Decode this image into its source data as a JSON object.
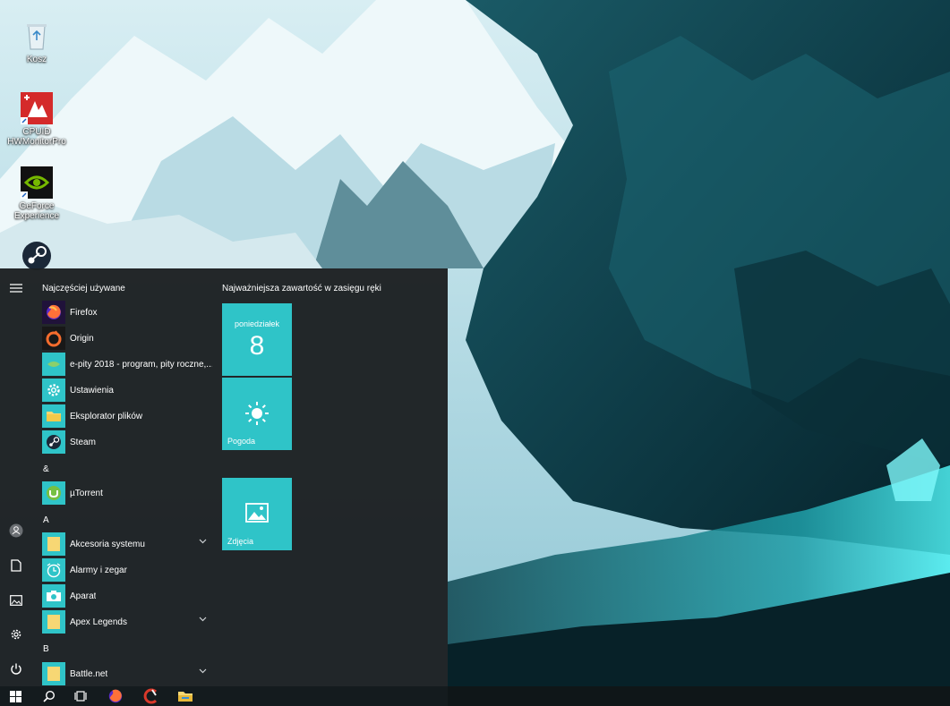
{
  "desktop": {
    "icons": [
      {
        "label": "Kosz",
        "icon": "recycle-bin-icon"
      },
      {
        "label": "CPUID\nHWMonitorPro",
        "icon": "hwmonitor-icon"
      },
      {
        "label": "GeForce Experience",
        "icon": "nvidia-icon"
      },
      {
        "label": "",
        "icon": "steam-icon"
      }
    ]
  },
  "start_menu": {
    "most_used_title": "Najczęściej używane",
    "tiles_title": "Najważniejsza zawartość w zasięgu ręki",
    "most_used": [
      {
        "label": "Firefox",
        "icon": "firefox-icon"
      },
      {
        "label": "Origin",
        "icon": "origin-icon"
      },
      {
        "label": "e-pity 2018 - program, pity roczne,...",
        "icon": "e-pity-icon"
      },
      {
        "label": "Ustawienia",
        "icon": "settings-gear-icon"
      },
      {
        "label": "Eksplorator plików",
        "icon": "folder-icon"
      },
      {
        "label": "Steam",
        "icon": "steam-icon"
      }
    ],
    "groups": [
      {
        "letter": "&",
        "items": [
          {
            "label": "µTorrent",
            "icon": "utorrent-icon",
            "expandable": false
          }
        ]
      },
      {
        "letter": "A",
        "items": [
          {
            "label": "Akcesoria systemu",
            "icon": "folder-icon",
            "expandable": true
          },
          {
            "label": "Alarmy i zegar",
            "icon": "alarm-clock-icon",
            "expandable": false
          },
          {
            "label": "Aparat",
            "icon": "camera-icon",
            "expandable": false
          },
          {
            "label": "Apex Legends",
            "icon": "folder-icon",
            "expandable": true
          }
        ]
      },
      {
        "letter": "B",
        "items": [
          {
            "label": "Battle.net",
            "icon": "folder-icon",
            "expandable": true
          }
        ]
      }
    ],
    "tiles": {
      "calendar": {
        "day": "poniedziałek",
        "date": "8"
      },
      "weather": {
        "label": "Pogoda"
      },
      "photos": {
        "label": "Zdjęcia"
      }
    },
    "rail": [
      "hamburger-menu-icon",
      "user-account-icon",
      "documents-icon",
      "pictures-icon",
      "settings-icon",
      "power-icon"
    ]
  },
  "taskbar": {
    "buttons": [
      "windows-start-icon",
      "search-icon",
      "task-view-icon",
      "firefox-icon",
      "ccleaner-icon",
      "file-explorer-icon"
    ]
  },
  "colors": {
    "tile": "#2fc4c8",
    "app_icon_bg": "#2fc4c8",
    "menu_bg": "#1c1f21",
    "taskbar_bg": "#101618"
  }
}
